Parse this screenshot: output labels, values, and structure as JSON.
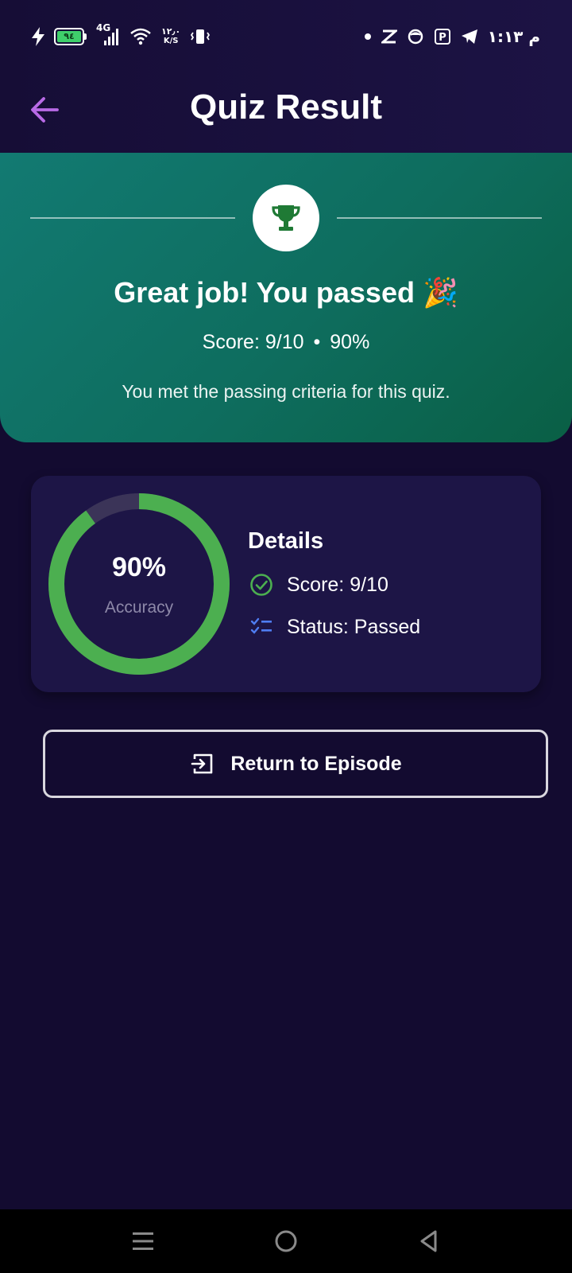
{
  "status_bar": {
    "battery_level": "٩٤",
    "network": "4G",
    "speed_value": "١٢٫٠",
    "speed_unit": "K/S",
    "clock": "م ١:١٣"
  },
  "app_bar": {
    "title": "Quiz Result"
  },
  "banner": {
    "headline": "Great job! You passed 🎉",
    "score_text": "Score: 9/10",
    "separator": "•",
    "percent_text": "90%",
    "criteria": "You met the passing criteria for this quiz."
  },
  "details_card": {
    "accuracy_value": "90%",
    "accuracy_label": "Accuracy",
    "accuracy_fraction": 0.9,
    "title": "Details",
    "rows": [
      {
        "icon": "check-circle-icon",
        "text": "Score: 9/10"
      },
      {
        "icon": "checklist-icon",
        "text": "Status: Passed"
      }
    ]
  },
  "actions": {
    "return_label": "Return to Episode"
  },
  "colors": {
    "background": "#130b30",
    "banner_start": "#127a72",
    "banner_end": "#0a5f45",
    "card": "#1d1546",
    "accent_purple": "#b86ae6",
    "ring_green": "#4caf50",
    "trophy_green": "#1f7a35",
    "checklist_blue": "#4f7df2"
  }
}
